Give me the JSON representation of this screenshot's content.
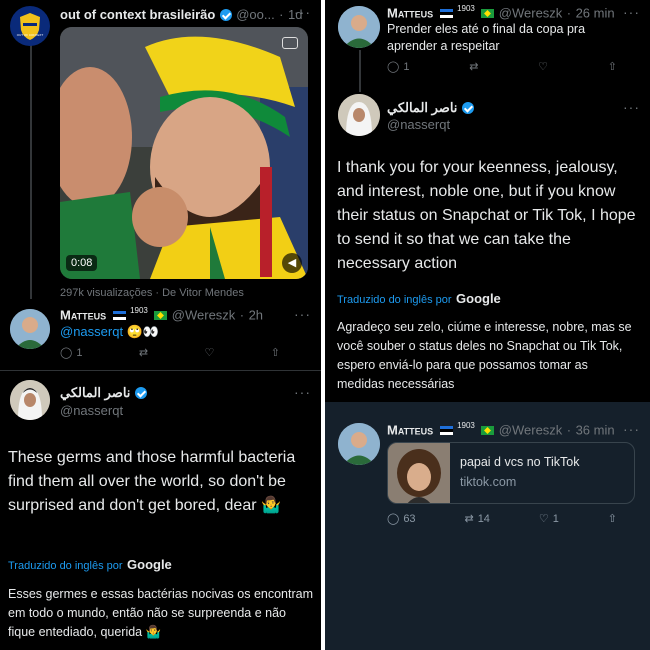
{
  "left": {
    "tweet1": {
      "name": "out of context brasileirão",
      "handle": "@oo...",
      "sep": "·",
      "time": "1d",
      "video_time": "0:08",
      "views": "297k visualizações · De Vitor Mendes"
    },
    "tweet2": {
      "name": "Matteus",
      "flag_num": "1903",
      "handle": "@Wereszk",
      "sep": "·",
      "time": "2h",
      "mention": "@nasserqt",
      "emoji": "🙄👀",
      "reply_count": "1"
    },
    "tweet3": {
      "name": "ناصر المالكي",
      "handle": "@nasserqt",
      "body": "These germs and those harmful bacteria find them all over the world, so don't be surprised and don't get bored, dear 🤷‍♂️",
      "translated_label": "Traduzido do inglês por",
      "google": "Google",
      "translation": "Esses germes e essas bactérias nocivas os encontram em todo o mundo, então não se surpreenda e não fique entediado, querida 🤷‍♂️"
    }
  },
  "right": {
    "tweet1": {
      "name": "Matteus",
      "flag_num": "1903",
      "handle": "@Wereszk",
      "sep": "·",
      "time": "26 min",
      "body": "Prender eles até o final da copa pra aprender a respeitar",
      "reply_count": "1"
    },
    "tweet2": {
      "name": "ناصر المالكي",
      "handle": "@nasserqt",
      "body": "I thank you for your keenness, jealousy, and interest, noble one, but if you know their status on Snapchat or Tik Tok, I hope to send it so that we can take the necessary action",
      "translated_label": "Traduzido do inglês por",
      "google": "Google",
      "translation": "Agradeço seu zelo, ciúme e interesse, nobre, mas se você souber o status deles no Snapchat ou Tik Tok, espero enviá-lo para que possamos tomar as medidas necessárias"
    },
    "tweet3": {
      "name": "Matteus",
      "flag_num": "1903",
      "handle": "@Wereszk",
      "sep": "·",
      "time": "36 min",
      "card_title": "papai d vcs no TikTok",
      "card_domain": "tiktok.com",
      "reply_count": "63",
      "retweet_count": "14",
      "like_count": "1"
    }
  },
  "icons": {
    "reply": "reply-icon",
    "retweet": "retweet-icon",
    "like": "heart-icon",
    "share": "share-icon",
    "more": "more-icon",
    "verified": "verified-badge-icon",
    "sound": "speaker-icon",
    "gif": "media-icon"
  },
  "colors": {
    "background": "#000000",
    "link": "#1d9bf0",
    "muted": "#71767b",
    "text": "#e7e9ea",
    "highlight_bg": "#15202b"
  }
}
